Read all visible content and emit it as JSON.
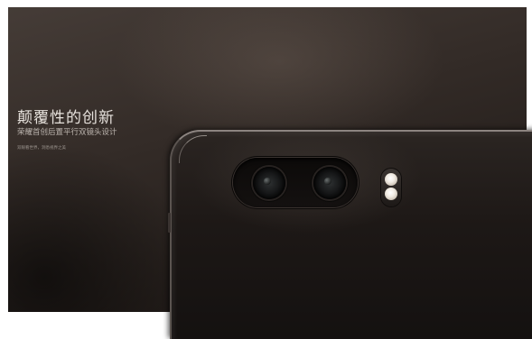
{
  "hero": {
    "headline": "颠覆性的创新",
    "subheadline": "荣耀首创后置平行双镜头设计",
    "tagline": "双眼看世界，洞悉视界之美"
  },
  "device": {
    "lens_icon": "camera-lens-icon",
    "flash_icon": "dual-led-flash-icon"
  },
  "colors": {
    "background": "#2c2521",
    "headline": "#e6e1dc",
    "phone_edge": "#8c8480"
  }
}
